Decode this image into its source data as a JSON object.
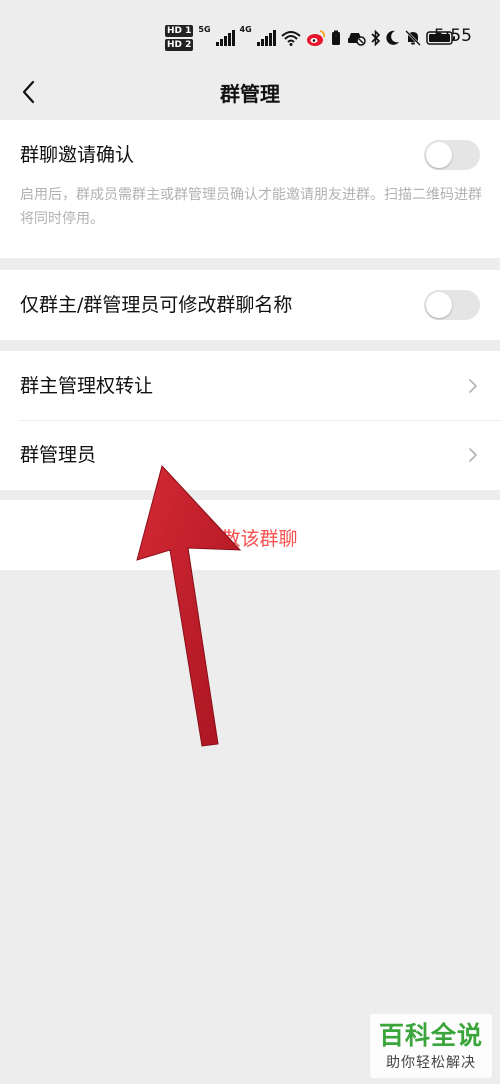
{
  "status_bar": {
    "hd_top": "HD 1",
    "hd_bottom": "HD 2",
    "net1": "5G",
    "net2": "4G",
    "time": "5:55"
  },
  "nav": {
    "title": "群管理"
  },
  "settings": {
    "invite_confirm": {
      "label": "群聊邀请确认",
      "description": "启用后，群成员需群主或群管理员确认才能邀请朋友进群。扫描二维码进群将同时停用。",
      "enabled": false
    },
    "name_edit_restrict": {
      "label": "仅群主/群管理员可修改群聊名称",
      "enabled": false
    },
    "transfer_owner": {
      "label": "群主管理权转让"
    },
    "admins": {
      "label": "群管理员"
    },
    "dissolve": {
      "label": "解散该群聊"
    }
  },
  "colors": {
    "background": "#ededed",
    "danger": "#fa5151",
    "annotation_arrow": "#c8222f",
    "watermark_green": "#3aa53a"
  },
  "watermark": {
    "title": "百科全说",
    "subtitle": "助你轻松解决"
  }
}
